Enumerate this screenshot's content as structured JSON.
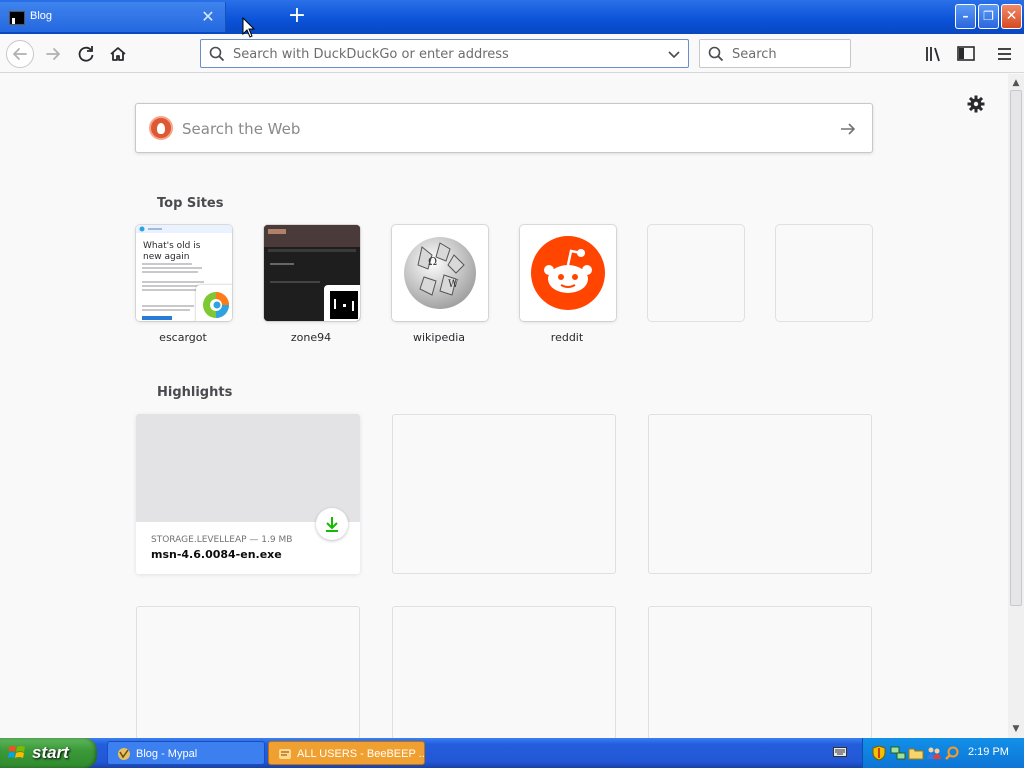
{
  "window": {
    "tab_title": "Blog",
    "tab_close": "✕",
    "new_tab": "+",
    "min": "–",
    "max": "❐",
    "close": "✕"
  },
  "toolbar": {
    "url_placeholder": "Search with DuckDuckGo or enter address",
    "search_placeholder": "Search"
  },
  "newtab": {
    "web_search_placeholder": "Search the Web",
    "top_sites_title": "Top Sites",
    "top_sites": [
      {
        "label": "escargot"
      },
      {
        "label": "zone94"
      },
      {
        "label": "wikipedia"
      },
      {
        "label": "reddit"
      }
    ],
    "escargot_preview_text": "What's old is new again",
    "highlights_title": "Highlights",
    "highlight": {
      "source": "STORAGE.LEVELLEAP — 1.9 MB",
      "title": "msn-4.6.0084-en.exe"
    }
  },
  "taskbar": {
    "start_label": "start",
    "tasks": [
      {
        "label": "Blog - Mypal"
      },
      {
        "label": "ALL USERS - BeeBEEP ..."
      }
    ],
    "clock": "2:19 PM"
  },
  "colors": {
    "accent": "#0a52d8",
    "ddg": "#de5833",
    "reddit": "#ff4500",
    "download_green": "#12bc00"
  }
}
